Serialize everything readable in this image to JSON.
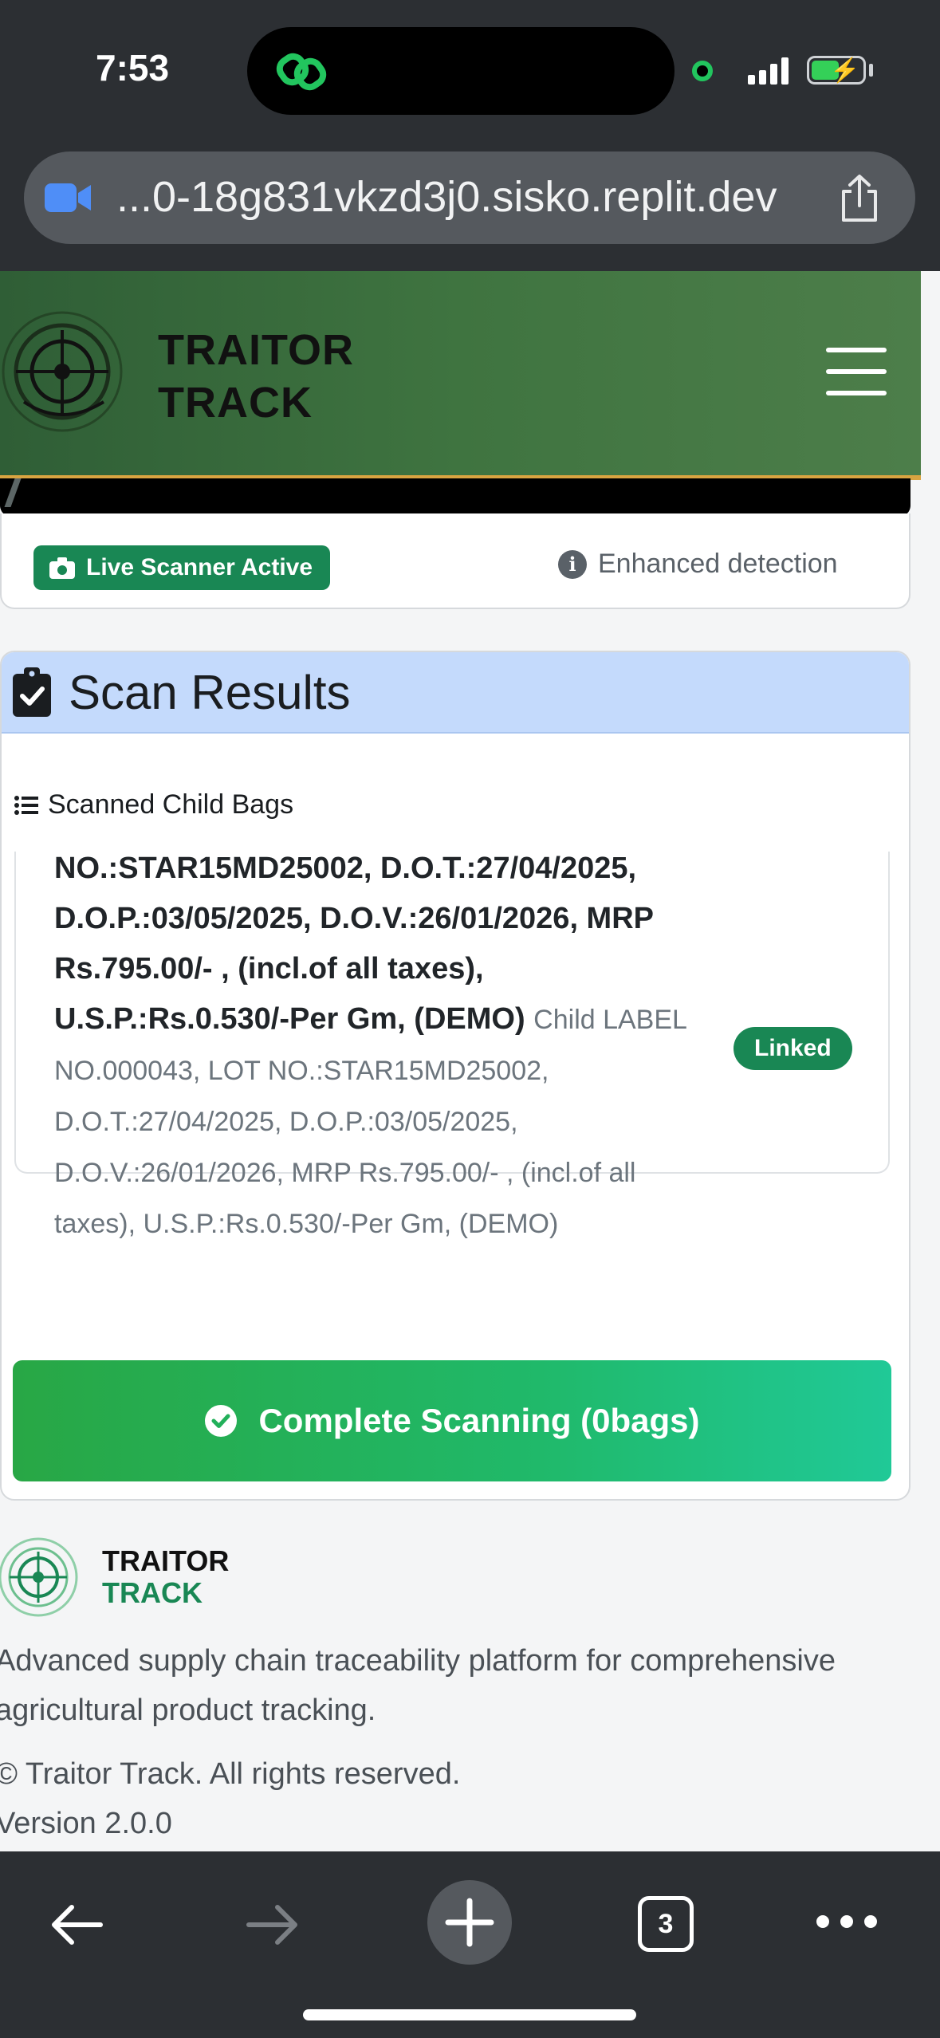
{
  "status_bar": {
    "time": "7:53"
  },
  "browser": {
    "url": "...0-18g831vkzd3j0.sisko.replit.dev",
    "open_tabs": "3"
  },
  "header": {
    "brand_line1": "TRAITOR",
    "brand_line2": "TRACK"
  },
  "scanner": {
    "live_badge": "Live Scanner Active",
    "enhanced_label": "Enhanced detection"
  },
  "results": {
    "title": "Scan Results",
    "child_bags_label": "Scanned Child Bags",
    "item": {
      "title": "NO.:STAR15MD25002, D.O.T.:27/04/2025, D.O.P.:03/05/2025, D.O.V.:26/01/2026, MRP Rs.795.00/- , (incl.of all taxes), U.S.P.:Rs.0.530/-Per Gm, (DEMO)",
      "subtitle": "Child LABEL NO.000043, LOT NO.:STAR15MD25002, D.O.T.:27/04/2025, D.O.P.:03/05/2025, D.O.V.:26/01/2026, MRP Rs.795.00/- , (incl.of all taxes), U.S.P.:Rs.0.530/-Per Gm, (DEMO)",
      "status": "Linked"
    },
    "complete_button": "Complete Scanning (0bags)"
  },
  "footer": {
    "brand_line1": "TRAITOR",
    "brand_line2": "TRACK",
    "description": "Advanced supply chain traceability platform for comprehensive agricultural product tracking.",
    "copyright": "© Traitor Track. All rights reserved.",
    "version": "Version 2.0.0"
  },
  "colors": {
    "header_green": "#3f7440",
    "accent_gold": "#d9a441",
    "success_green": "#198754",
    "results_header_blue": "#c4dafc"
  }
}
